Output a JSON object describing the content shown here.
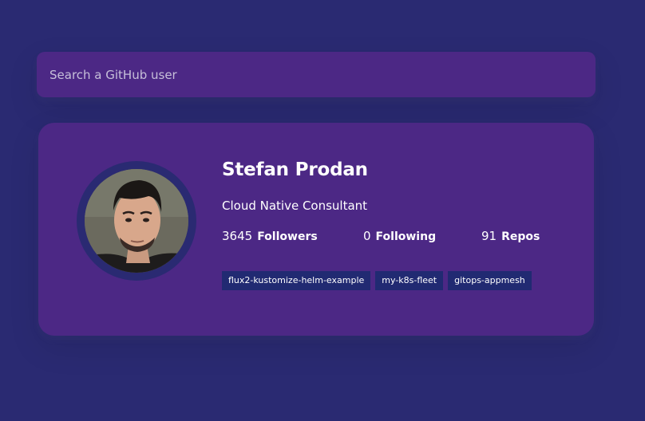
{
  "search": {
    "placeholder": "Search a GitHub user",
    "value": ""
  },
  "profile": {
    "name": "Stefan Prodan",
    "bio": "Cloud Native Consultant",
    "avatar_icon": "user-avatar-photo",
    "stats": {
      "followers": {
        "count": "3645",
        "label": "Followers"
      },
      "following": {
        "count": "0",
        "label": "Following"
      },
      "repos": {
        "count": "91",
        "label": "Repos"
      }
    },
    "repos": [
      {
        "name": "flux2-kustomize-helm-example"
      },
      {
        "name": "my-k8s-fleet"
      },
      {
        "name": "gitops-appmesh"
      }
    ]
  },
  "colors": {
    "background": "#2a2a72",
    "card": "#4c2885",
    "repo_tag": "#212a72",
    "text": "#ffffff"
  }
}
